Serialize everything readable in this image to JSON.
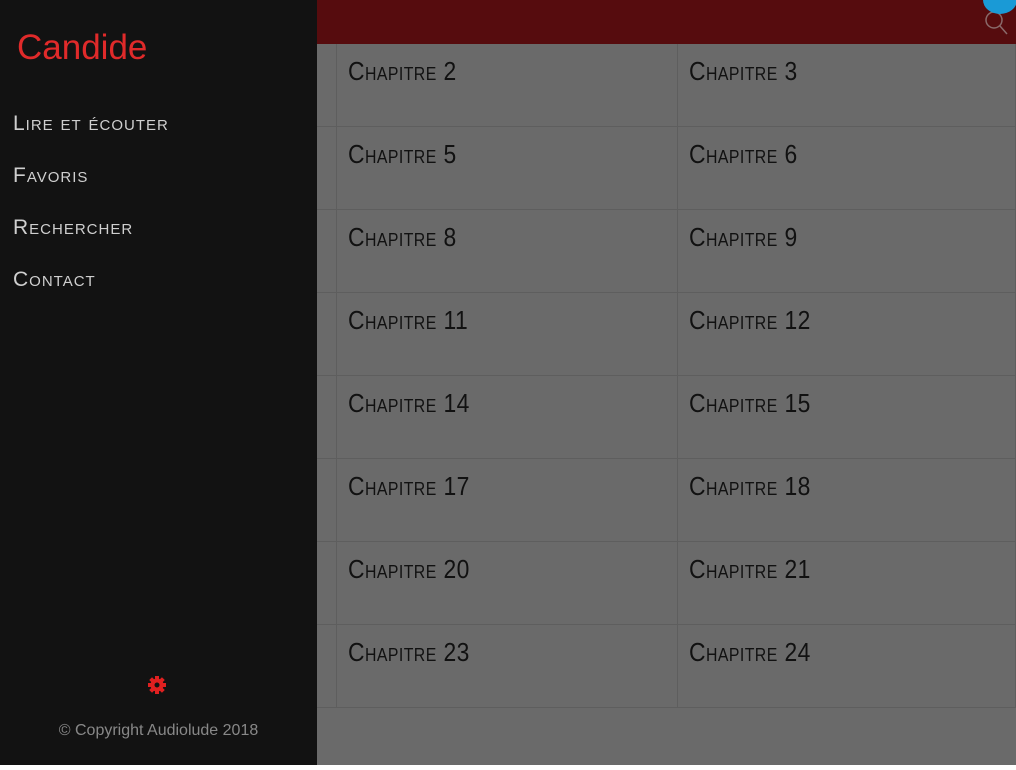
{
  "sidebar": {
    "brand": "Candide",
    "items": [
      {
        "label": "Lire et écouter"
      },
      {
        "label": "Favoris"
      },
      {
        "label": "Rechercher"
      },
      {
        "label": "Contact"
      }
    ],
    "settings_icon": "gear-icon",
    "copyright": "© Copyright Audiolude 2018"
  },
  "header": {
    "search_icon": "search-icon",
    "badge_icon": "chat-badge-icon"
  },
  "colors": {
    "header": "#560c0e",
    "sidebar": "#121212",
    "brand": "#e02a2a",
    "overlay": "#6a6a6a",
    "badge": "#1a9ad6"
  },
  "chapters": [
    [
      "Chapitre 2",
      "Chapitre 3"
    ],
    [
      "Chapitre 5",
      "Chapitre 6"
    ],
    [
      "Chapitre 8",
      "Chapitre 9"
    ],
    [
      "Chapitre 11",
      "Chapitre 12"
    ],
    [
      "Chapitre 14",
      "Chapitre 15"
    ],
    [
      "Chapitre 17",
      "Chapitre 18"
    ],
    [
      "Chapitre 20",
      "Chapitre 21"
    ],
    [
      "Chapitre 23",
      "Chapitre 24"
    ]
  ]
}
